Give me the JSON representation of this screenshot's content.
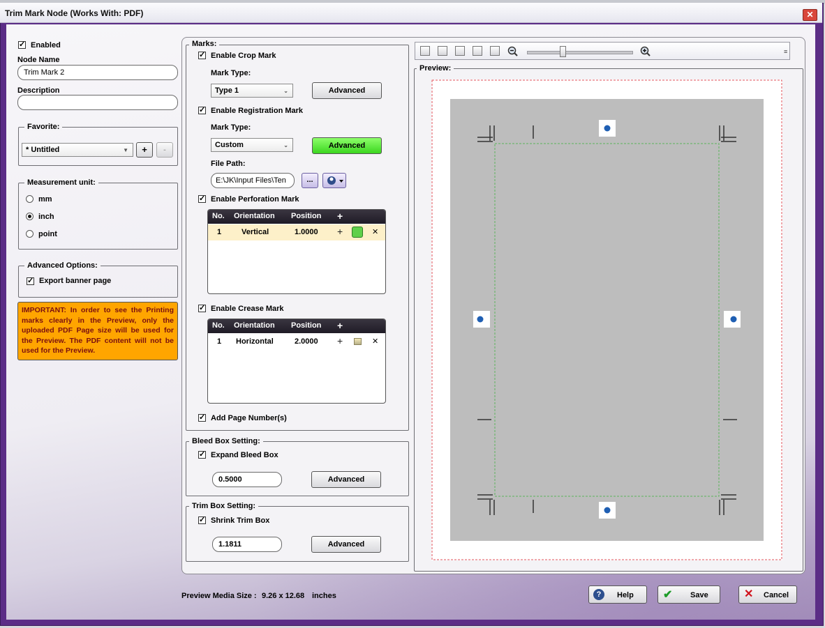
{
  "window": {
    "title": "Trim Mark Node (Works With: PDF)",
    "close_glyph": "✕"
  },
  "left": {
    "enabled_label": "Enabled",
    "node_name_label": "Node Name",
    "node_name_value": "Trim Mark 2",
    "description_label": "Description",
    "description_value": "",
    "favorite": {
      "title": "Favorite:",
      "selected": "* Untitled",
      "add_label": "+",
      "remove_label": "-"
    },
    "measurement": {
      "title": "Measurement unit:",
      "options": [
        "mm",
        "inch",
        "point"
      ],
      "selected": "inch"
    },
    "advanced_options": {
      "title": "Advanced Options:",
      "export_banner_label": "Export banner page"
    },
    "important_note": "IMPORTANT: In order to see the Printing marks clearly in the Preview, only the uploaded PDF Page size will be used for the Preview. The PDF content will not be used for the Preview."
  },
  "marks": {
    "title": "Marks:",
    "crop": {
      "label": "Enable Crop Mark",
      "mark_type_label": "Mark Type:",
      "mark_type": "Type 1",
      "advanced": "Advanced"
    },
    "registration": {
      "label": "Enable Registration Mark",
      "mark_type_label": "Mark Type:",
      "mark_type": "Custom",
      "advanced": "Advanced",
      "file_path_label": "File Path:",
      "file_path": "E:\\JK\\Input Files\\Ten",
      "browse": "..."
    },
    "perforation": {
      "label": "Enable Perforation Mark",
      "headers": [
        "No.",
        "Orientation",
        "Position",
        "+"
      ],
      "rows": [
        {
          "no": "1",
          "orientation": "Vertical",
          "position": "1.0000"
        }
      ]
    },
    "crease": {
      "label": "Enable Crease Mark",
      "headers": [
        "No.",
        "Orientation",
        "Position",
        "+"
      ],
      "rows": [
        {
          "no": "1",
          "orientation": "Horizontal",
          "position": "2.0000"
        }
      ]
    },
    "row_actions": {
      "add": "+",
      "remove": "✕"
    },
    "page_numbers_label": "Add Page Number(s)"
  },
  "bleed": {
    "title": "Bleed Box Setting:",
    "expand_label": "Expand Bleed Box",
    "value": "0.5000",
    "advanced": "Advanced"
  },
  "trim": {
    "title": "Trim Box Setting:",
    "shrink_label": "Shrink Trim Box",
    "value": "1.1811",
    "advanced": "Advanced"
  },
  "preview": {
    "title": "Preview:",
    "zoom_level": 0.32,
    "media_size_label": "Preview Media Size :",
    "media_size_value": "9.26 x 12.68",
    "media_size_unit": "inches",
    "colors": {
      "page_bg": "#bdbdbd",
      "bleed_border": "#e0505a",
      "trim_border": "#5ab35a"
    }
  },
  "footer": {
    "help": "Help",
    "save": "Save",
    "cancel": "Cancel"
  },
  "colors": {
    "window_frame": "#5b2d86",
    "note_bg": "#ffa500",
    "green_button": "#5be23a"
  }
}
